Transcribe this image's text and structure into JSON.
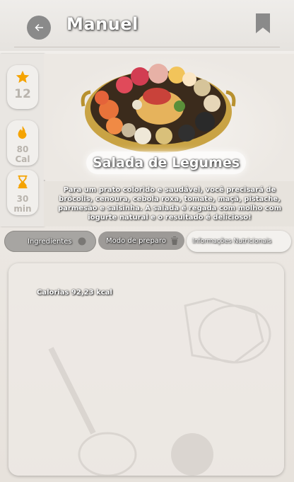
{
  "header": {
    "title": "Manuel"
  },
  "stats": {
    "rating": "12",
    "calories_value": "80",
    "calories_unit": "Cal",
    "time_value": "30",
    "time_unit": "min"
  },
  "recipe": {
    "name": "Salada de Legumes",
    "description": "Para um prato colorido e saudável, você precisará de brócolis, cenoura, cebola roxa, tomate, maçã, pistache, parmesão e salsinha. A salada é regada com molho com iogurte natural e o resultado é delicioso!"
  },
  "tabs": {
    "ingredients": "Ingredientes",
    "preparation": "Modo de preparo",
    "nutrition": "Informações Nutricionais"
  },
  "nutrition": {
    "calories": "Calorias 92,23 kcal"
  },
  "colors": {
    "accent": "#f5a300",
    "muted": "#b9b4ad"
  },
  "icons": [
    "back-arrow-icon",
    "bookmark-icon",
    "star-icon",
    "flame-icon",
    "hourglass-icon",
    "circle-icon",
    "trash-icon"
  ]
}
